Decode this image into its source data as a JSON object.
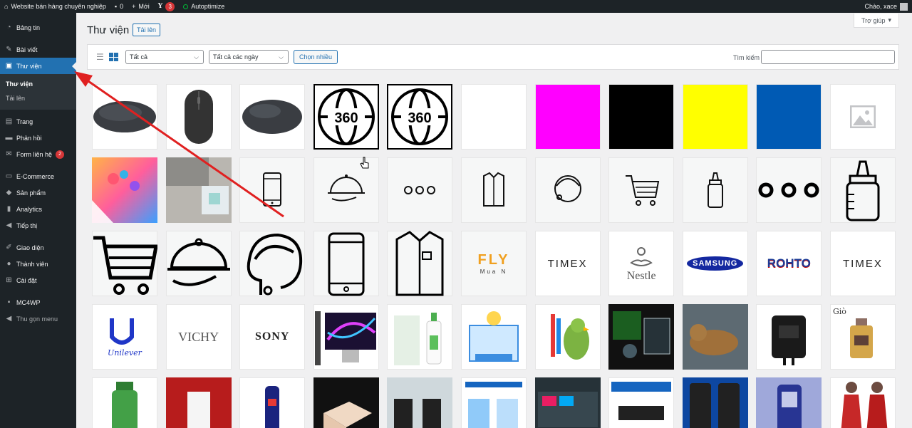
{
  "adminbar": {
    "site_name": "Website bán hàng chuyên nghiệp",
    "comments_count": "0",
    "new_label": "Mới",
    "yoast_count": "3",
    "autoptimize_label": "Autoptimize",
    "greeting": "Chào, xace"
  },
  "sidebar": {
    "items": [
      {
        "label": "Bảng tin",
        "icon": "dashboard-icon"
      },
      {
        "label": "Bài viết",
        "icon": "pin-icon"
      },
      {
        "label": "Thư viện",
        "icon": "media-icon"
      },
      {
        "label": "Trang",
        "icon": "page-icon"
      },
      {
        "label": "Phản hồi",
        "icon": "comment-icon"
      },
      {
        "label": "Form liên hệ",
        "icon": "mail-icon",
        "badge": "2"
      },
      {
        "label": "E-Commerce",
        "icon": "ecommerce-icon"
      },
      {
        "label": "Sản phẩm",
        "icon": "product-icon"
      },
      {
        "label": "Analytics",
        "icon": "analytics-icon"
      },
      {
        "label": "Tiếp thị",
        "icon": "megaphone-icon"
      },
      {
        "label": "Giao diện",
        "icon": "appearance-icon"
      },
      {
        "label": "Thành viên",
        "icon": "users-icon"
      },
      {
        "label": "Cài đặt",
        "icon": "settings-icon"
      },
      {
        "label": "MC4WP",
        "icon": "mc4wp-icon"
      },
      {
        "label": "Thu gọn menu",
        "icon": "collapse-icon"
      }
    ],
    "submenu": [
      "Thư viện",
      "Tải lên"
    ]
  },
  "help_tab": "Trợ giúp",
  "page": {
    "title": "Thư viện",
    "add_new": "Tải lên"
  },
  "toolbar": {
    "type_filter": "Tất cả",
    "date_filter": "Tất cả các ngày",
    "bulk_select": "Chọn nhiều",
    "search_label": "Tìm kiếm",
    "search_value": ""
  },
  "brands": {
    "fly": "FLY",
    "fly_sub": "Mua N",
    "timex": "TIMEX",
    "nestle": "Nestle",
    "samsung": "SAMSUNG",
    "rohto": "ROHTO",
    "unilever": "Unilever",
    "vichy": "VICHY",
    "sony": "SONY",
    "gio": "Giò",
    "label_360": "360"
  },
  "colors": {
    "accent": "#2271b1",
    "magenta": "#ff00ff",
    "black": "#000000",
    "yellow": "#ffff00",
    "blue": "#005ab4",
    "arrow": "#e02020"
  }
}
